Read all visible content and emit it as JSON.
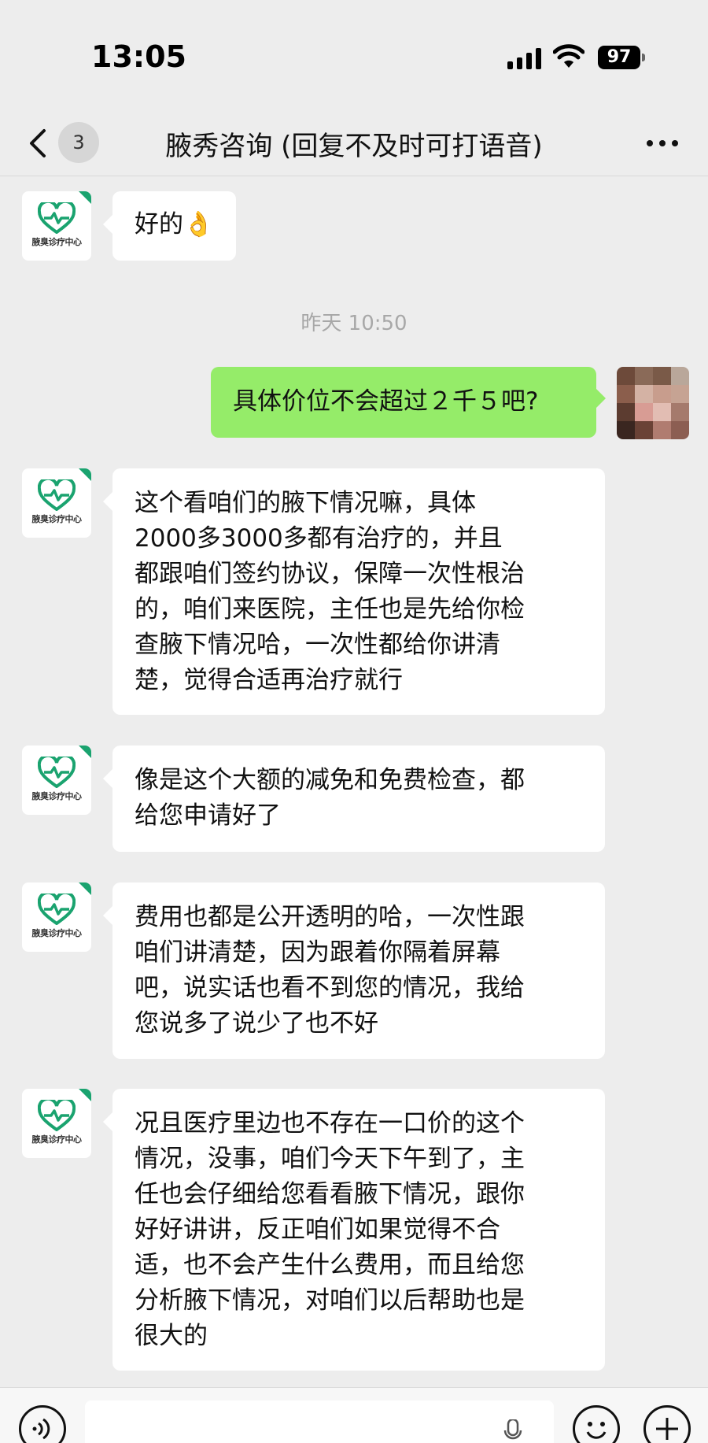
{
  "status_bar": {
    "time": "13:05",
    "battery": "97",
    "icons": [
      "signal-icon",
      "wifi-icon",
      "battery-icon"
    ]
  },
  "nav": {
    "unread_count": "3",
    "title": "腋秀咨询 (回复不及时可打语音)",
    "icons": [
      "back-icon",
      "more-icon"
    ]
  },
  "contact_avatar": {
    "logo_text": "腋臭诊疗中心",
    "accent_color": "#1aa36f"
  },
  "messages": [
    {
      "side": "left",
      "lines": [
        "好的👌"
      ]
    },
    {
      "side": "time",
      "text": "昨天 10:50"
    },
    {
      "side": "right",
      "lines": [
        "具体价位不会超过２千５吧?"
      ]
    },
    {
      "side": "left",
      "lines": [
        "这个看咱们的腋下情况嘛，具体",
        "2000多3000多都有治疗的，并且",
        "都跟咱们签约协议，保障一次性根治",
        "的，咱们来医院，主任也是先给你检",
        "查腋下情况哈，一次性都给你讲清",
        "楚，觉得合适再治疗就行"
      ]
    },
    {
      "side": "left",
      "lines": [
        "像是这个大额的减免和免费检查，都",
        "给您申请好了"
      ]
    },
    {
      "side": "left",
      "lines": [
        "费用也都是公开透明的哈，一次性跟",
        "咱们讲清楚，因为跟着你隔着屏幕",
        "吧，说实话也看不到您的情况，我给",
        "您说多了说少了也不好"
      ]
    },
    {
      "side": "left",
      "lines": [
        "况且医疗里边也不存在一口价的这个",
        "情况，没事，咱们今天下午到了，主",
        "任也会仔细给您看看腋下情况，跟你",
        "好好讲讲，反正咱们如果觉得不合",
        "适，也不会产生什么费用，而且给您",
        "分析腋下情况，对咱们以后帮助也是",
        "很大的"
      ]
    }
  ],
  "colors": {
    "background": "#ededed",
    "outgoing_bubble": "#95ec69",
    "incoming_bubble": "#ffffff",
    "timestamp": "#a8a8a8"
  },
  "input_bar": {
    "icons": [
      "voice-icon",
      "mic-icon",
      "emoji-icon",
      "plus-icon"
    ]
  }
}
